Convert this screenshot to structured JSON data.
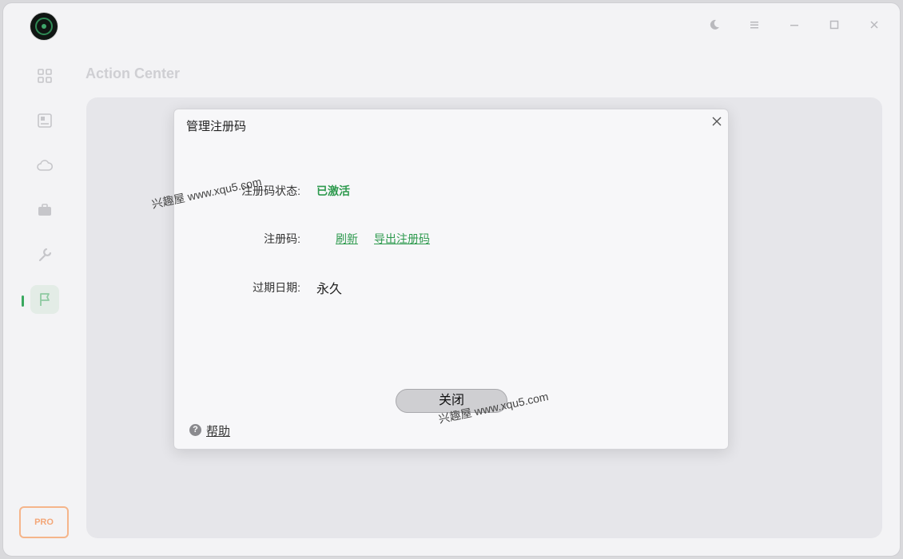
{
  "app": {
    "page_title": "Action Center",
    "pro_badge": "PRO"
  },
  "window_controls": {
    "theme_icon": "moon-icon",
    "menu_icon": "menu-icon",
    "minimize_icon": "minimize-icon",
    "maximize_icon": "maximize-icon",
    "close_icon": "close-icon"
  },
  "sidebar": {
    "items": [
      {
        "icon": "apps-icon"
      },
      {
        "icon": "gallery-icon"
      },
      {
        "icon": "cloud-icon"
      },
      {
        "icon": "toolbox-icon"
      },
      {
        "icon": "wrench-icon"
      },
      {
        "icon": "flag-icon",
        "active": true
      }
    ]
  },
  "dialog": {
    "title": "管理注册码",
    "status_label": "注册码状态:",
    "status_value": "已激活",
    "code_label": "注册码:",
    "refresh_link": "刷新",
    "export_link": "导出注册码",
    "expiry_label": "过期日期:",
    "expiry_value": "永久",
    "close_button": "关闭",
    "help_label": "帮助"
  },
  "watermarks": {
    "text": "兴趣屋 www.xqu5.com"
  },
  "colors": {
    "accent_green": "#2e9a4e",
    "pro_orange": "#f3a677"
  }
}
